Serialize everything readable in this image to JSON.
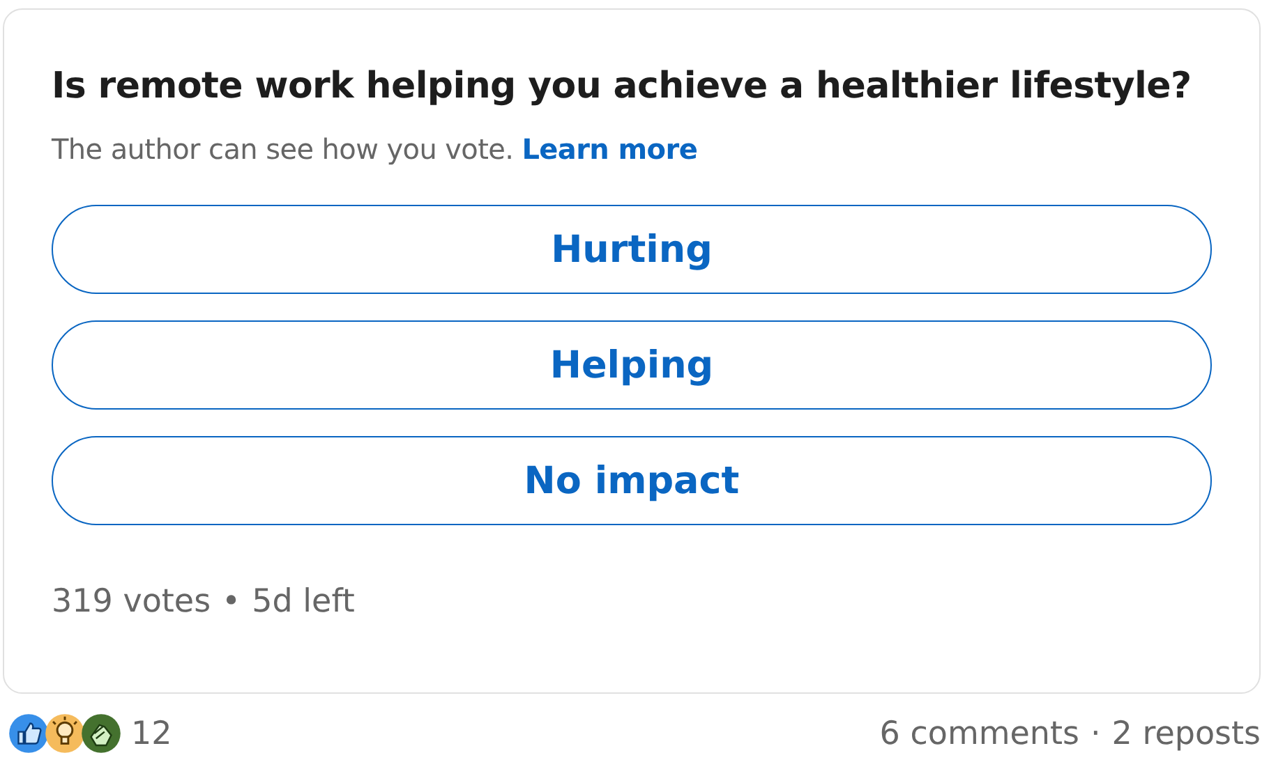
{
  "poll": {
    "question": "Is remote work helping you achieve a healthier lifestyle?",
    "notice": "The author can see how you vote.",
    "learn_more": "Learn more",
    "options": [
      {
        "label": "Hurting"
      },
      {
        "label": "Helping"
      },
      {
        "label": "No impact"
      }
    ],
    "votes": "319 votes",
    "separator": "•",
    "time_left": "5d left"
  },
  "social": {
    "reaction_count": "12",
    "comments": "6 comments",
    "dot": "·",
    "reposts": "2 reposts"
  }
}
